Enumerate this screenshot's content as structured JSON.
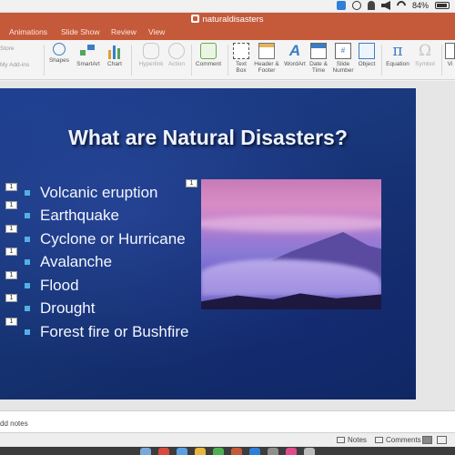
{
  "window": {
    "title": "naturaldisasters"
  },
  "menubar": {
    "battery": "84%"
  },
  "tabs": [
    {
      "label": "Animations",
      "name": "tab-animations"
    },
    {
      "label": "Slide Show",
      "name": "tab-slide-show"
    },
    {
      "label": "Review",
      "name": "tab-review"
    },
    {
      "label": "View",
      "name": "tab-view"
    }
  ],
  "ribbon": {
    "left_stub": "Store",
    "left_stub2": "My Add-ins",
    "items": [
      {
        "label": "Shapes",
        "icon": "shapes-icon",
        "enabled": true
      },
      {
        "label": "SmartArt",
        "icon": "smartart-icon",
        "enabled": true
      },
      {
        "label": "Chart",
        "icon": "chart-icon",
        "enabled": true
      },
      {
        "label": "Hyperlink",
        "icon": "hyperlink-icon",
        "enabled": false
      },
      {
        "label": "Action",
        "icon": "action-icon",
        "enabled": false
      },
      {
        "label": "Comment",
        "icon": "comment-icon",
        "enabled": true
      },
      {
        "label": "Text Box",
        "icon": "textbox-icon",
        "enabled": true
      },
      {
        "label": "Header & Footer",
        "icon": "header-footer-icon",
        "enabled": true
      },
      {
        "label": "WordArt",
        "icon": "wordart-icon",
        "enabled": true
      },
      {
        "label": "Date & Time",
        "icon": "date-time-icon",
        "enabled": true
      },
      {
        "label": "Slide Number",
        "icon": "slide-number-icon",
        "enabled": true
      },
      {
        "label": "Object",
        "icon": "object-icon",
        "enabled": true
      },
      {
        "label": "Equation",
        "icon": "equation-icon",
        "enabled": true
      },
      {
        "label": "Symbol",
        "icon": "symbol-icon",
        "enabled": false
      },
      {
        "label": "Vi",
        "icon": "video-icon",
        "enabled": true
      }
    ],
    "wordart_glyph": "A",
    "equation_glyph": "π",
    "symbol_glyph": "Ω",
    "slidenum_glyph": "#"
  },
  "slide": {
    "title": "What are Natural Disasters?",
    "bullets": [
      "Volcanic eruption",
      "Earthquake",
      "Cyclone or Hurricane",
      "Avalanche",
      "Flood",
      "Drought",
      "Forest fire or Bushfire"
    ],
    "animation_tag": "1",
    "bullet_color": "#4fb1e6"
  },
  "notes": {
    "placeholder": "dd notes"
  },
  "statusbar": {
    "notes": "Notes",
    "comments": "Comments"
  }
}
